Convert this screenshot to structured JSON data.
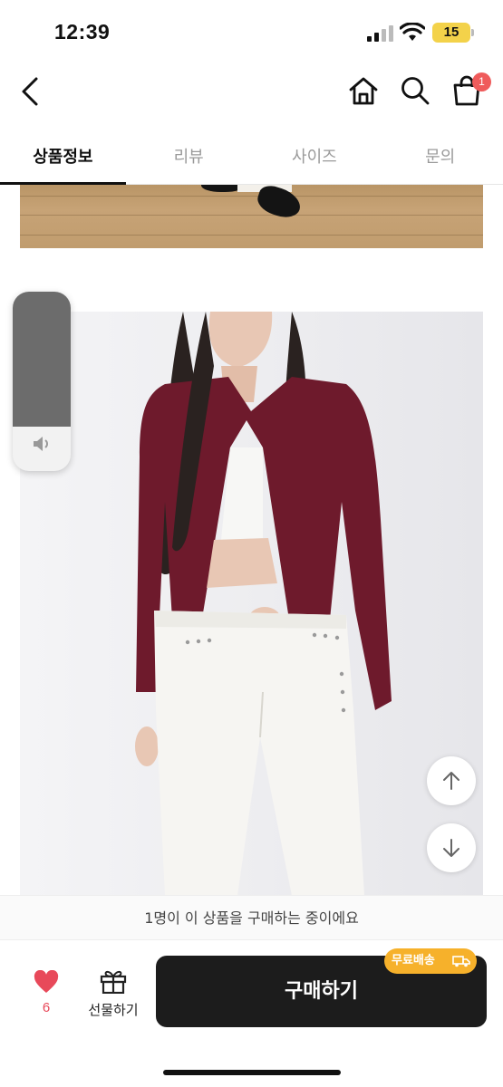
{
  "status_bar": {
    "time": "12:39",
    "battery": "15"
  },
  "header": {
    "cart_count": "1"
  },
  "tabs": [
    {
      "label": "상품정보",
      "active": true
    },
    {
      "label": "리뷰",
      "active": false
    },
    {
      "label": "사이즈",
      "active": false
    },
    {
      "label": "문의",
      "active": false
    }
  ],
  "volume_level": 0.75,
  "banner_text": "1명이 이 상품을 구매하는 중이에요",
  "bottom_bar": {
    "like_count": "6",
    "gift_label": "선물하기",
    "buy_label": "구매하기",
    "free_shipping_badge": "무료배송"
  },
  "colors": {
    "accent_red": "#e8495a",
    "badge_orange": "#f6b12b",
    "buy_button": "#1c1c1c",
    "cardigan": "#6e1a2c"
  }
}
